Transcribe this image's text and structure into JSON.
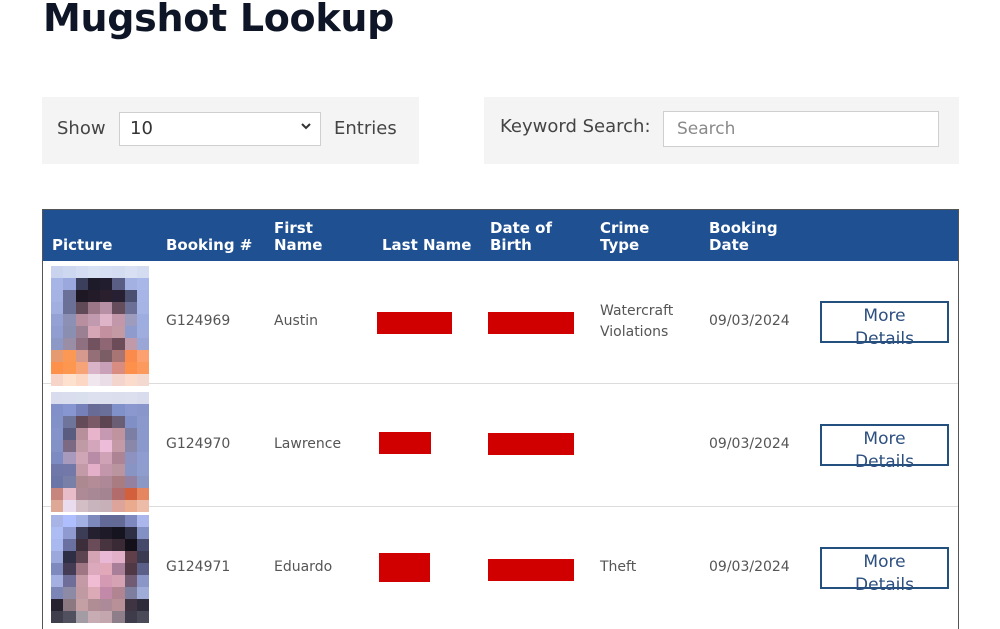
{
  "page": {
    "title": "Mugshot Lookup"
  },
  "controls": {
    "show_label": "Show",
    "entries_value": "10",
    "entries_label": "Entries",
    "keyword_label": "Keyword Search:",
    "search_placeholder": "Search",
    "search_value": ""
  },
  "table": {
    "columns": [
      "Picture",
      "Booking #",
      "First Name",
      "Last Name",
      "Date of Birth",
      "Crime Type",
      "Booking Date",
      ""
    ],
    "header_lines": {
      "picture": [
        "Picture"
      ],
      "booking": [
        "Booking #"
      ],
      "first_name": [
        "First",
        "Name"
      ],
      "last_name": [
        "Last Name"
      ],
      "dob": [
        "Date of",
        "Birth"
      ],
      "crime": [
        "Crime",
        "Type"
      ],
      "booking_date": [
        "Booking",
        "Date"
      ]
    },
    "rows": [
      {
        "booking": "G124969",
        "first_name": "Austin",
        "last_name_redacted": true,
        "dob_redacted": true,
        "crime_lines": [
          "Watercraft",
          "Violations"
        ],
        "booking_date": "09/03/2024",
        "button": [
          "More",
          "Details"
        ]
      },
      {
        "booking": "G124970",
        "first_name": "Lawrence",
        "last_name_redacted": true,
        "dob_redacted": true,
        "crime_lines": [
          "",
          ""
        ],
        "booking_date": "09/03/2024",
        "button": [
          "More",
          "Details"
        ]
      },
      {
        "booking": "G124971",
        "first_name": "Eduardo",
        "last_name_redacted": true,
        "dob_redacted": true,
        "crime_lines": [
          "Theft",
          ""
        ],
        "booking_date": "09/03/2024",
        "button": [
          "More",
          "Details"
        ]
      }
    ]
  },
  "colors": {
    "header_blue": "#1f5091",
    "redaction_red": "#d00000",
    "button_border": "#24507f",
    "panel_bg": "#f4f4f4"
  },
  "icons": {
    "select_chevron": "chevron-down-icon"
  }
}
